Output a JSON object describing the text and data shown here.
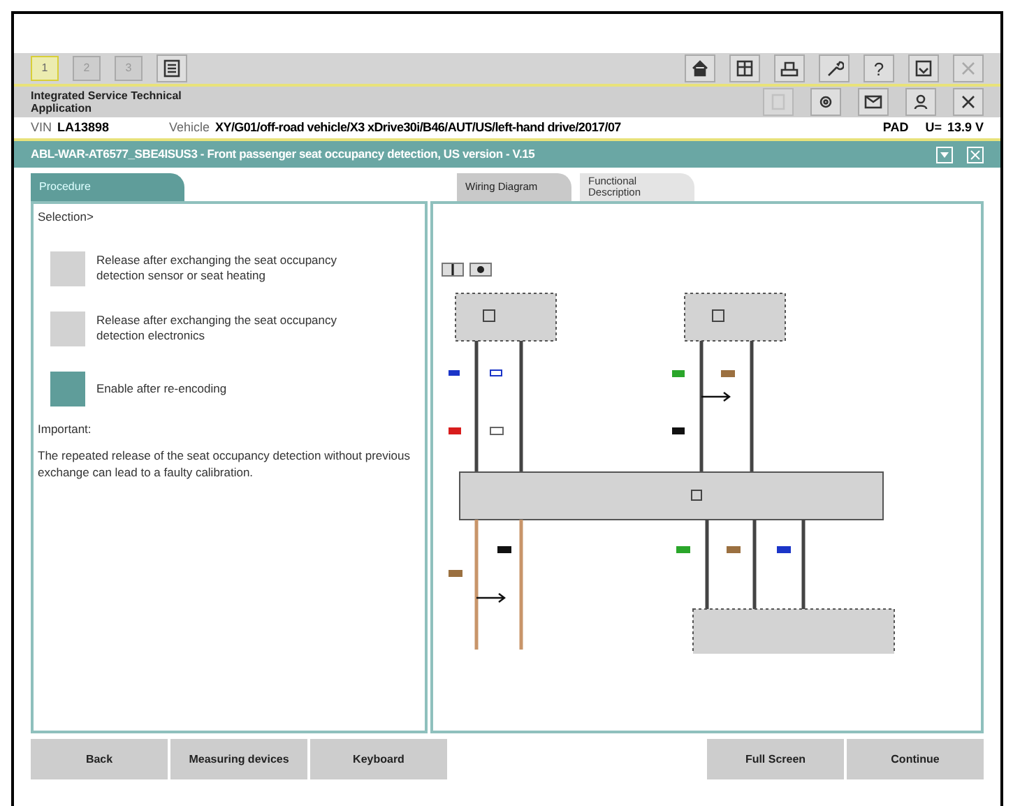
{
  "toolbar": {
    "steps": [
      {
        "label": "1",
        "selected": true
      },
      {
        "label": "2",
        "selected": false
      },
      {
        "label": "3",
        "selected": false
      }
    ],
    "help_label": "?"
  },
  "app": {
    "title": "Integrated Service Technical Application"
  },
  "vehicle_bar": {
    "vin_label": "VIN",
    "vin": "LA13898",
    "vehicle_label": "Vehicle",
    "vehicle": "XY/G01/off-road vehicle/X3 xDrive30i/B46/AUT/US/left-hand drive/2017/07",
    "pad": "PAD",
    "voltage_label": "U=",
    "voltage": "13.9 V"
  },
  "document": {
    "title": "ABL-WAR-AT6577_SBE4ISUS3 - Front passenger seat occupancy detection, US version - V.15"
  },
  "left_tab": {
    "label": "Procedure",
    "selected": true
  },
  "right_tabs": [
    {
      "label": "Wiring Diagram",
      "selected": true
    },
    {
      "label": "Functional Description",
      "selected": false
    }
  ],
  "procedure": {
    "heading": "Selection>",
    "options": [
      {
        "label": "Release after exchanging the seat occupancy detection sensor or seat heating",
        "selected": false
      },
      {
        "label": "Release after exchanging the seat occupancy detection electronics",
        "selected": false
      },
      {
        "label": "Enable after re-encoding",
        "selected": true
      }
    ],
    "note_label": "Important:",
    "note": "The repeated release of the seat occupancy detection without previous exchange can lead to a faulty calibration."
  },
  "buttons_left": [
    "Back",
    "Measuring devices",
    "Keyboard"
  ],
  "buttons_right": [
    "Full Screen",
    "Continue"
  ]
}
